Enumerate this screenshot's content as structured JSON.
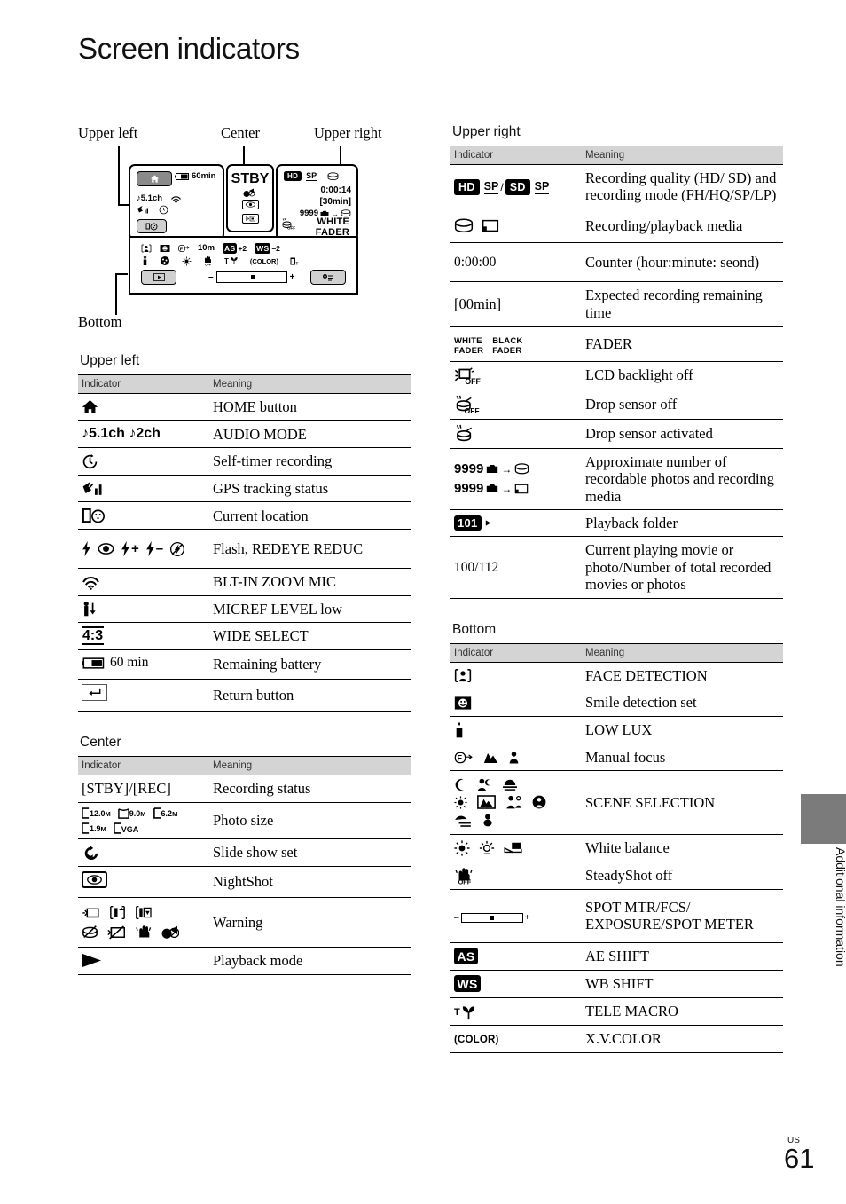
{
  "page": {
    "title": "Screen indicators",
    "page_number": "61",
    "region_code": "US",
    "side_tab_label": "Additional information"
  },
  "diagram": {
    "labels": {
      "upper_left": "Upper left",
      "center": "Center",
      "upper_right": "Upper right",
      "bottom": "Bottom"
    },
    "upper_left_panel": {
      "home_icon": "home-icon",
      "battery_icon": "battery-icon",
      "battery_text": "60min",
      "audio_text": "5.1ch",
      "zoom_mic_icon": "zoom-mic-icon",
      "gps_icon": "gps-icon",
      "self_timer_icon": "self-timer-icon",
      "location_button_icon": "current-location-icon"
    },
    "center_panel": {
      "status": "STBY",
      "warning_icon": "warning-lens-icon",
      "nightshot_icon": "nightshot-icon",
      "micref_icon": "micref-level-icon"
    },
    "upper_right_panel": {
      "quality_badge": "HD",
      "mode": "SP",
      "media_icon": "hdd-icon",
      "counter": "0:00:14",
      "remaining": "[30min]",
      "photo_count": "9999",
      "photo_icon": "photo-icon",
      "arrow": "→",
      "target_media_icon": "hdd-icon",
      "drop_sensor_icon": "drop-sensor-off-icon",
      "fader_line1": "WHITE",
      "fader_line2": "FADER"
    },
    "bottom_panel": {
      "row1": [
        "face-detection-icon",
        "smile-detection-icon",
        "manual-focus-icon",
        "10m",
        "AS",
        "+2",
        "WS",
        "-2"
      ],
      "row2": [
        "low-lux-icon",
        "scene-selection-icon",
        "white-balance-icon",
        "steadyshot-off-icon",
        "tele-macro-icon",
        "x-v-color-icon",
        "spot-meter-icon"
      ],
      "playback_button_icon": "playback-mode-icon",
      "options_button_icon": "options-icon",
      "slider_minus": "–",
      "slider_plus": "+"
    }
  },
  "tables": {
    "headers": {
      "indicator": "Indicator",
      "meaning": "Meaning"
    },
    "upper_left": {
      "title": "Upper left",
      "rows": [
        {
          "icons": [
            "home-icon"
          ],
          "meaning": "HOME button"
        },
        {
          "text": "♪5.1ch  ♪2ch",
          "meaning": "AUDIO MODE"
        },
        {
          "icons": [
            "self-timer-icon"
          ],
          "meaning": "Self-timer recording"
        },
        {
          "icons": [
            "gps-tracking-icon"
          ],
          "meaning": "GPS tracking status"
        },
        {
          "icons": [
            "current-location-icon"
          ],
          "meaning": "Current location"
        },
        {
          "icons": [
            "flash-icon",
            "redeye-icon",
            "flash-plus-icon",
            "flash-minus-icon",
            "flash-off-icon"
          ],
          "meaning": "Flash, REDEYE REDUC"
        },
        {
          "icons": [
            "zoom-mic-icon"
          ],
          "meaning": "BLT-IN ZOOM MIC"
        },
        {
          "icons": [
            "micref-level-low-icon"
          ],
          "meaning": "MICREF LEVEL low"
        },
        {
          "text": "4:3",
          "meaning": "WIDE SELECT"
        },
        {
          "text": "60 min",
          "icons": [
            "battery-icon"
          ],
          "meaning": "Remaining battery"
        },
        {
          "icons": [
            "return-button-icon"
          ],
          "meaning": "Return button"
        }
      ]
    },
    "center": {
      "title": "Center",
      "rows": [
        {
          "text": "[STBY]/[REC]",
          "meaning": "Recording status"
        },
        {
          "text": "12.0M 9.0M 6.2M 1.9M VGA",
          "meaning": "Photo size"
        },
        {
          "icons": [
            "slide-show-icon"
          ],
          "meaning": "Slide show set"
        },
        {
          "icons": [
            "nightshot-icon"
          ],
          "meaning": "NightShot"
        },
        {
          "icons": [
            "warning-icons"
          ],
          "meaning": "Warning"
        },
        {
          "icons": [
            "playback-mode-icon"
          ],
          "meaning": "Playback mode"
        }
      ]
    },
    "upper_right": {
      "title": "Upper right",
      "rows": [
        {
          "text": "HD SP / SD SP",
          "meaning": "Recording quality (HD/ SD) and recording mode (FH/HQ/SP/LP)"
        },
        {
          "icons": [
            "hdd-icon",
            "memory-card-icon"
          ],
          "meaning": "Recording/playback media"
        },
        {
          "text": "0:00:00",
          "meaning": "Counter (hour:minute: seond)"
        },
        {
          "text": "[00min]",
          "meaning": "Expected recording remaining time"
        },
        {
          "text": "WHITE FADER  BLACK FADER",
          "meaning": "FADER"
        },
        {
          "icons": [
            "lcd-backlight-off-icon"
          ],
          "meaning": "LCD backlight off"
        },
        {
          "icons": [
            "drop-sensor-off-icon"
          ],
          "meaning": "Drop sensor off"
        },
        {
          "icons": [
            "drop-sensor-on-icon"
          ],
          "meaning": "Drop sensor activated"
        },
        {
          "text": "9999 → HDD / 9999 → card",
          "meaning": "Approximate number of recordable photos and recording media"
        },
        {
          "text": "101",
          "meaning": "Playback folder"
        },
        {
          "text": "100/112",
          "meaning": "Current playing movie or photo/Number of total recorded movies or photos"
        }
      ]
    },
    "bottom": {
      "title": "Bottom",
      "rows": [
        {
          "icons": [
            "face-detection-icon"
          ],
          "meaning": "FACE DETECTION"
        },
        {
          "icons": [
            "smile-detection-icon"
          ],
          "meaning": "Smile detection set"
        },
        {
          "icons": [
            "low-lux-icon"
          ],
          "meaning": "LOW LUX"
        },
        {
          "icons": [
            "manual-focus-icon",
            "mountain-icon",
            "person-icon"
          ],
          "meaning": "Manual focus"
        },
        {
          "icons": [
            "twilight-icon",
            "twilight-portrait-icon",
            "sunrise-sunset-icon",
            "fireworks-icon",
            "landscape-icon",
            "portrait-icon",
            "spotlight-icon",
            "beach-icon",
            "snow-icon"
          ],
          "meaning": "SCENE SELECTION"
        },
        {
          "icons": [
            "outdoor-wb-icon",
            "indoor-wb-icon",
            "one-push-wb-icon"
          ],
          "meaning": "White balance"
        },
        {
          "icons": [
            "steadyshot-off-icon"
          ],
          "meaning": "SteadyShot off"
        },
        {
          "icons": [
            "spot-meter-slider-icon"
          ],
          "meaning": "SPOT MTR/FCS/ EXPOSURE/SPOT METER"
        },
        {
          "text": "AS",
          "meaning": "AE SHIFT"
        },
        {
          "text": "WS",
          "meaning": "WB SHIFT"
        },
        {
          "text": "T",
          "icons": [
            "tele-macro-icon"
          ],
          "meaning": "TELE MACRO"
        },
        {
          "text": "(COLOR)",
          "meaning": "X.V.COLOR"
        }
      ]
    }
  },
  "colors": {
    "header_bg": "#d4d4d4",
    "tab_gray": "#7b7b7b",
    "button_gray": "#8a8a8a",
    "text": "#000000"
  }
}
